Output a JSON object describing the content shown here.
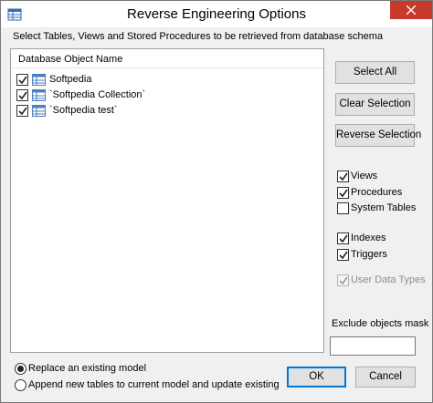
{
  "window": {
    "title": "Reverse Engineering Options",
    "close_icon": "close-icon"
  },
  "instruction": "Select Tables, Views and Stored Procedures to be retrieved from database schema",
  "list": {
    "column_header": "Database Object Name",
    "items": [
      {
        "label": "Softpedia",
        "checked": true
      },
      {
        "label": "`Softpedia Collection`",
        "checked": true
      },
      {
        "label": "`Softpedia test`",
        "checked": true
      }
    ]
  },
  "buttons": {
    "select_all": "Select All",
    "clear_selection": "Clear Selection",
    "reverse_selection": "Reverse Selection",
    "ok": "OK",
    "cancel": "Cancel"
  },
  "options": {
    "views": {
      "label": "Views",
      "checked": true
    },
    "procedures": {
      "label": "Procedures",
      "checked": true
    },
    "system_tables": {
      "label": "System Tables",
      "checked": false
    },
    "indexes": {
      "label": "Indexes",
      "checked": true
    },
    "triggers": {
      "label": "Triggers",
      "checked": true
    },
    "user_data_types": {
      "label": "User Data Types",
      "checked": true,
      "disabled": true
    }
  },
  "mask": {
    "label": "Exclude objects mask",
    "value": ""
  },
  "mode": {
    "replace": {
      "label": "Replace an existing model",
      "selected": true
    },
    "append": {
      "label": "Append new tables to current model and update existing",
      "selected": false
    }
  },
  "colors": {
    "accent": "#0078d7",
    "close_red": "#c7392b"
  }
}
